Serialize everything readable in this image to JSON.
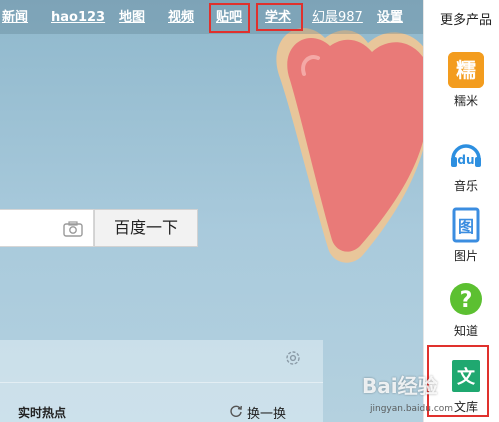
{
  "nav": {
    "links": [
      "新闻",
      "hao123",
      "地图",
      "视频",
      "贴吧",
      "学术",
      "幻晨987",
      "设置"
    ]
  },
  "search": {
    "button_label": "百度一下"
  },
  "hot": {
    "title": "实时热点",
    "refresh_label": "换一换"
  },
  "sidebar": {
    "title": "更多产品",
    "items": [
      {
        "label": "糯米",
        "icon": "nuomi-icon",
        "glyph": "糯",
        "color": "#f08a1c"
      },
      {
        "label": "音乐",
        "icon": "music-icon",
        "glyph": "du",
        "color": "#2d8fe0"
      },
      {
        "label": "图片",
        "icon": "image-icon",
        "glyph": "图",
        "color": "#3b8de0"
      },
      {
        "label": "知道",
        "icon": "zhidao-icon",
        "glyph": "?",
        "color": "#5cc031"
      },
      {
        "label": "文库",
        "icon": "wenku-icon",
        "glyph": "文",
        "color": "#1fa870"
      }
    ]
  },
  "watermark": {
    "brand": "Bai经验",
    "url": "jingyan.baidu.com"
  }
}
